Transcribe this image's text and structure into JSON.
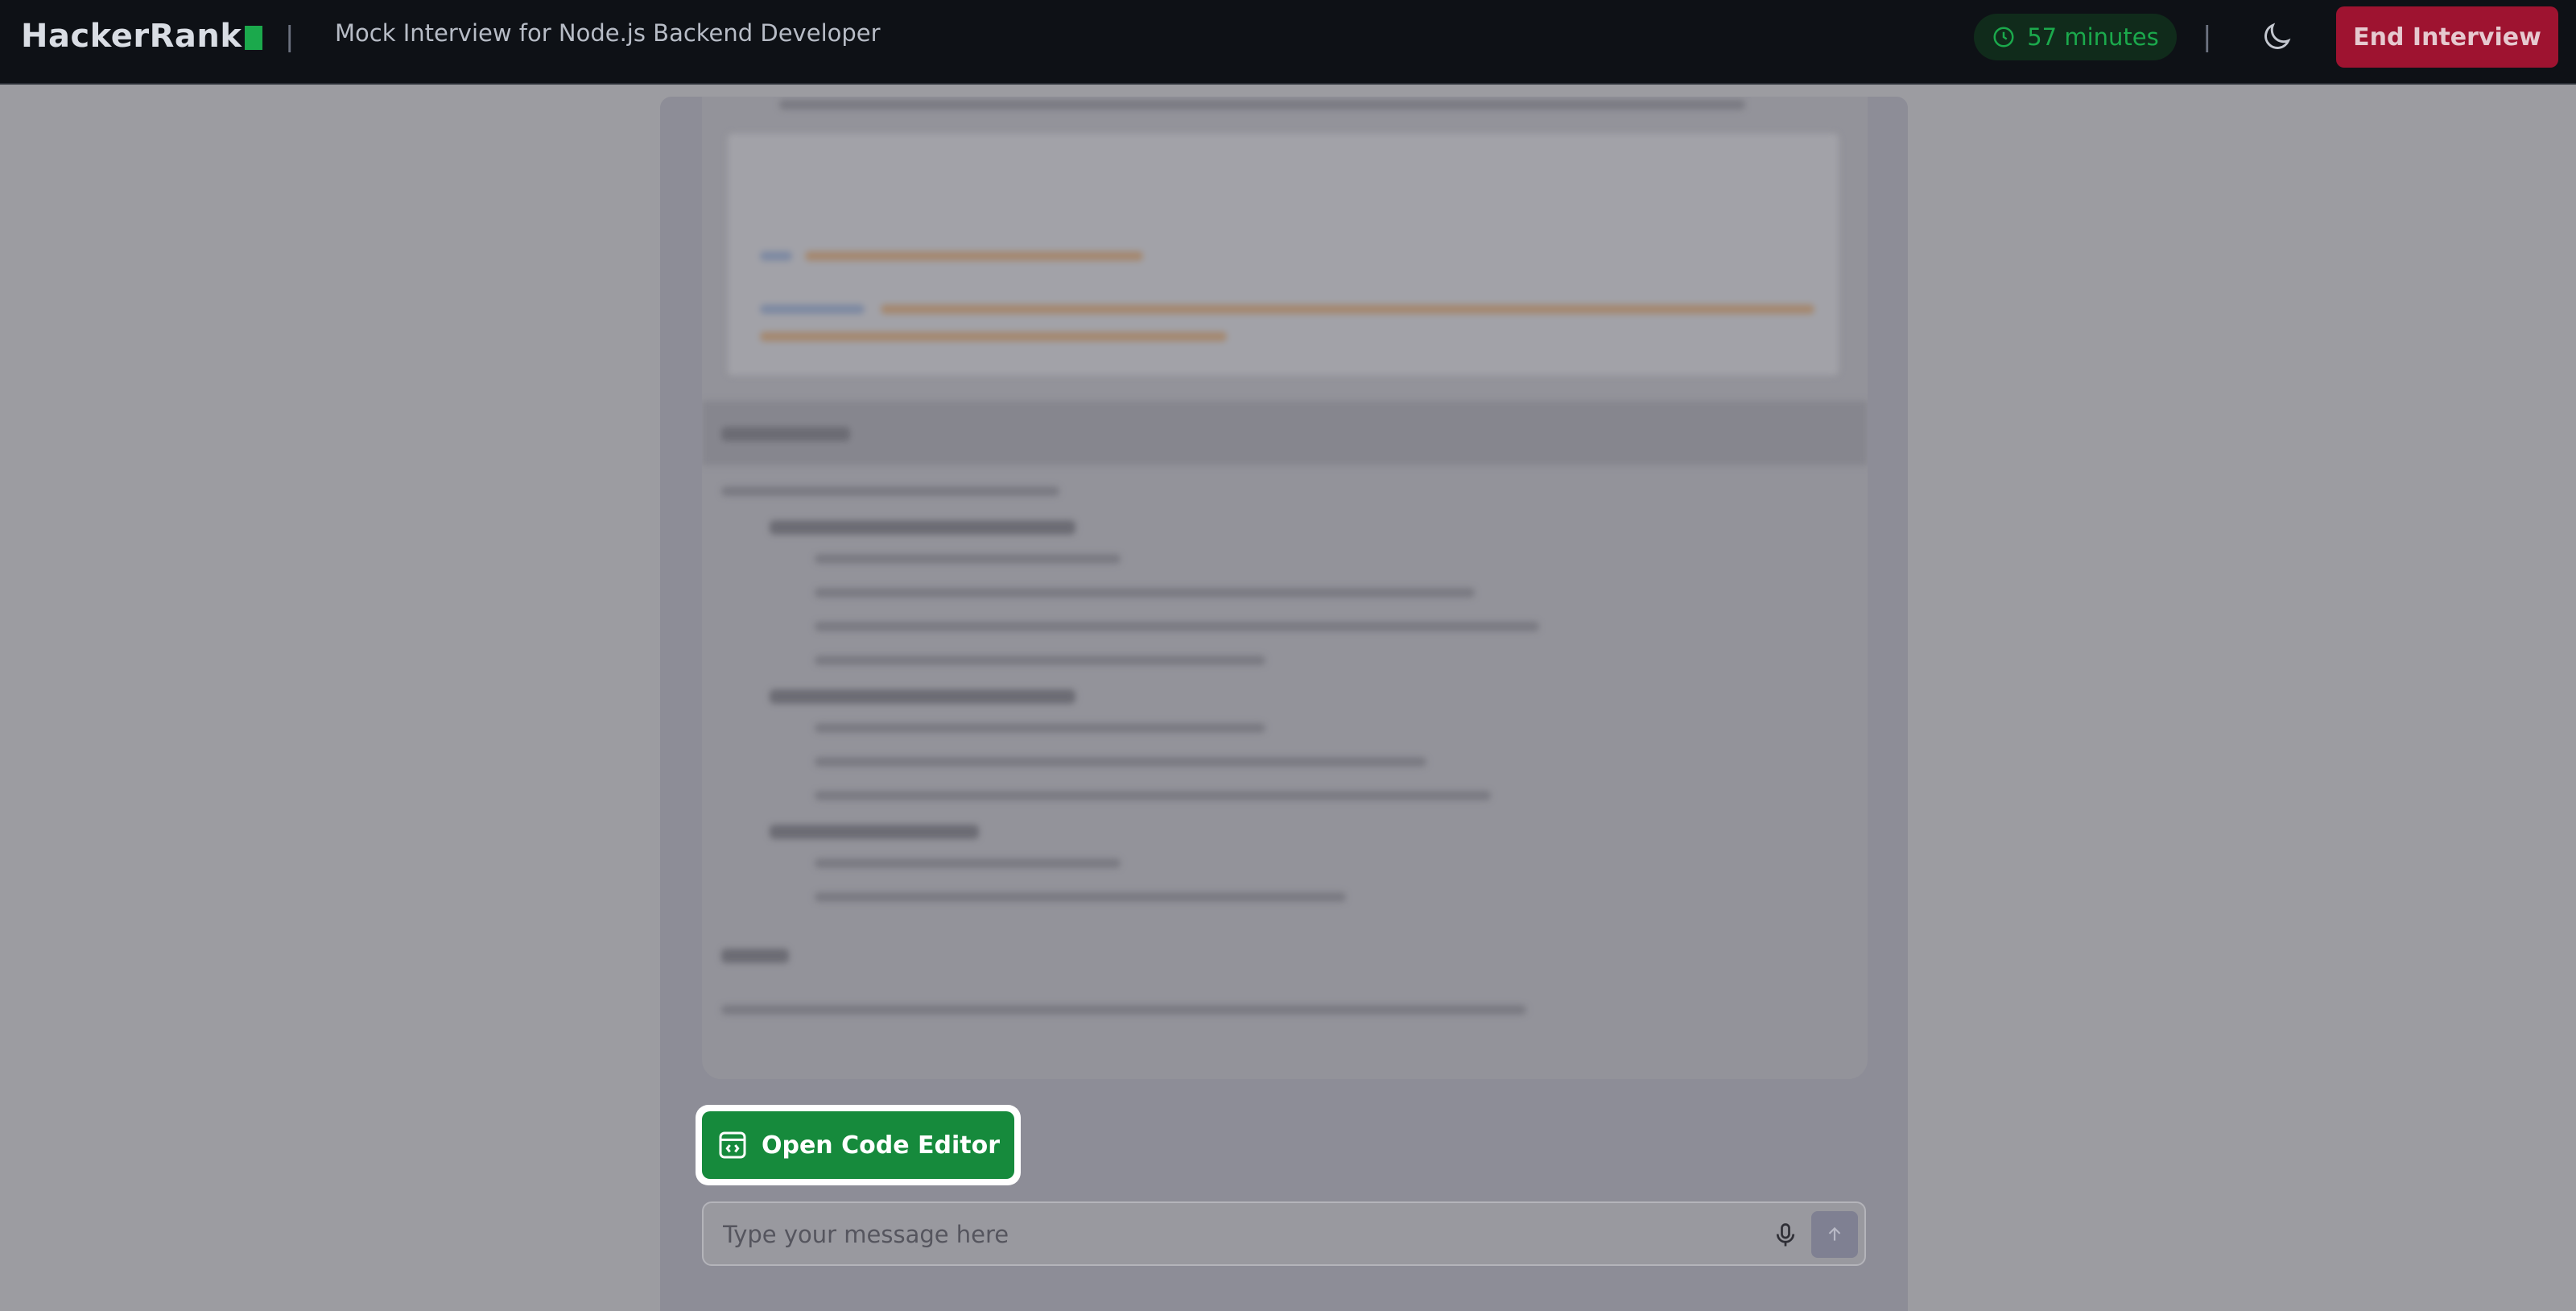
{
  "header": {
    "logo_text": "HackerRank",
    "divider": "|",
    "interview_title": "Mock Interview for Node.js Backend Developer",
    "timer_text": "57 minutes",
    "end_button_label": "End Interview",
    "icons": {
      "timer": "clock-icon",
      "theme_toggle": "moon-icon"
    }
  },
  "main": {
    "open_editor_label": "Open Code Editor",
    "editor_icon": "code-window-icon",
    "message_placeholder": "Type your message here",
    "mic_icon": "microphone-icon",
    "send_icon": "arrow-up-icon"
  },
  "colors": {
    "header_bg": "#0e1116",
    "brand_green": "#1ba94c",
    "editor_button": "#168a3c",
    "end_button": "#9e1330",
    "overlay_bg": "#9c9ca1"
  }
}
